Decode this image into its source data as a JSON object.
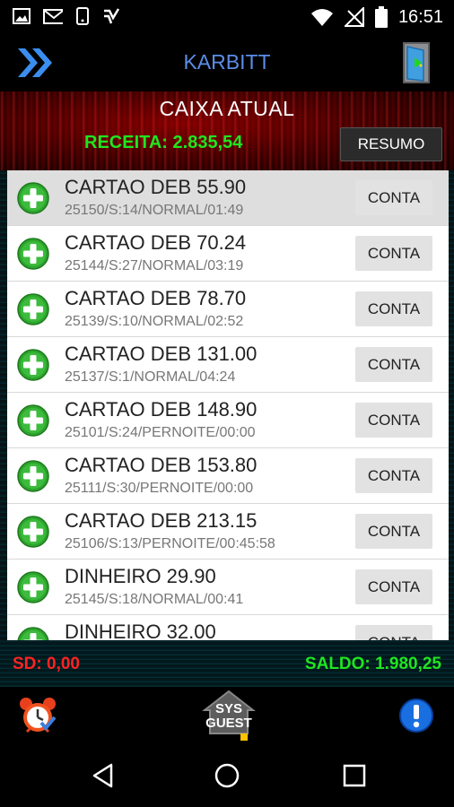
{
  "status_bar": {
    "time": "16:51",
    "icons": [
      "image-icon",
      "gmail-icon",
      "phone-icon",
      "check-app-icon",
      "wifi-icon",
      "no-signal-icon",
      "battery-icon"
    ]
  },
  "app_bar": {
    "title": "KARBITT",
    "menu_icon": "double-chevron-icon",
    "exit_icon": "door-exit-icon"
  },
  "header": {
    "title": "CAIXA ATUAL",
    "receita": "RECEITA: 2.835,54",
    "resumo_label": "RESUMO"
  },
  "list": {
    "button_label": "CONTA",
    "items": [
      {
        "main": "CARTAO DEB 55.90",
        "sub": "25150/S:14/NORMAL/01:49",
        "selected": true
      },
      {
        "main": "CARTAO DEB 70.24",
        "sub": "25144/S:27/NORMAL/03:19"
      },
      {
        "main": "CARTAO DEB 78.70",
        "sub": "25139/S:10/NORMAL/02:52"
      },
      {
        "main": "CARTAO DEB 131.00",
        "sub": "25137/S:1/NORMAL/04:24"
      },
      {
        "main": "CARTAO DEB 148.90",
        "sub": "25101/S:24/PERNOITE/00:00"
      },
      {
        "main": "CARTAO DEB 153.80",
        "sub": "25111/S:30/PERNOITE/00:00"
      },
      {
        "main": "CARTAO DEB 213.15",
        "sub": "25106/S:13/PERNOITE/00:45:58"
      },
      {
        "main": "DINHEIRO 29.90",
        "sub": "25145/S:18/NORMAL/00:41"
      },
      {
        "main": "DINHEIRO 32.00",
        "sub": ""
      }
    ]
  },
  "totals": {
    "sd": "SD: 0,00",
    "saldo": "SALDO: 1.980,25"
  },
  "bottom_bar": {
    "logo_line1": "SYS",
    "logo_line2": "GUEST"
  },
  "colors": {
    "accent_blue": "#5b8de8",
    "green": "#1fe61f",
    "red": "#ff2222",
    "plus_green": "#2ea52e"
  }
}
